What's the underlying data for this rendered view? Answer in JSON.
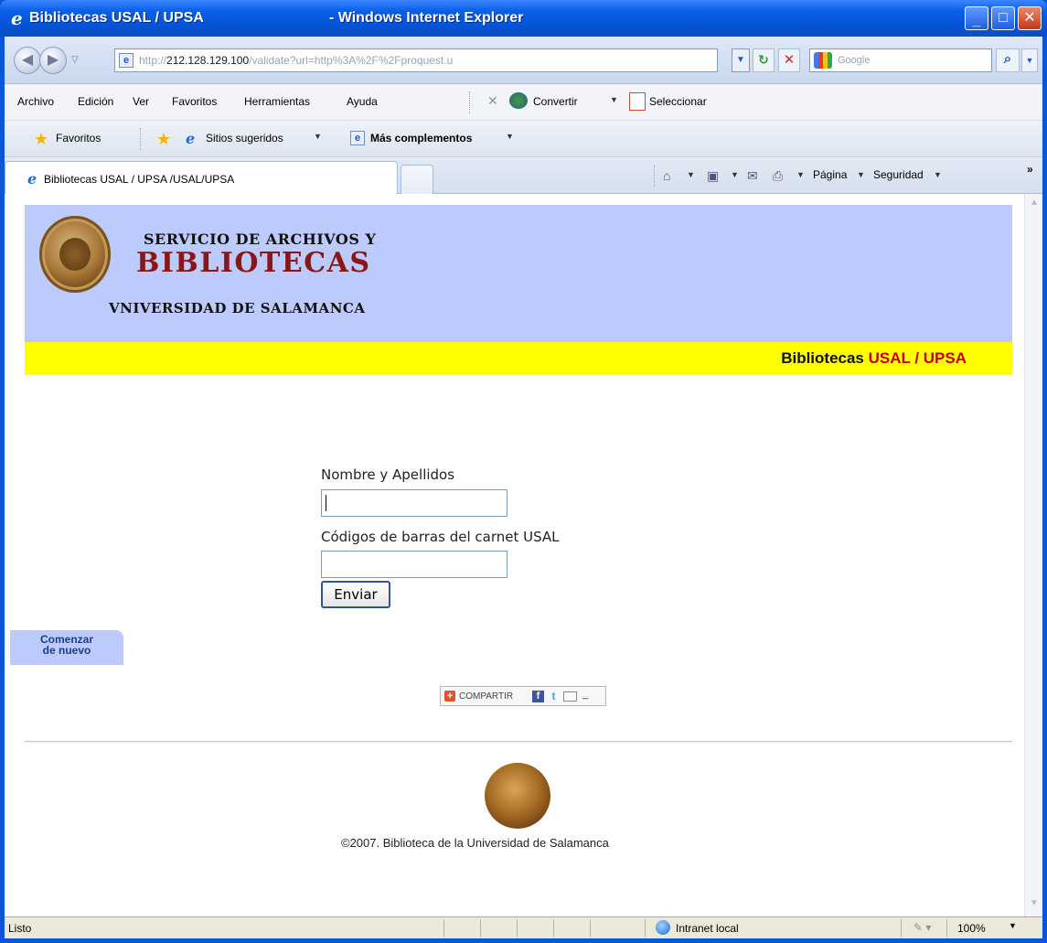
{
  "window": {
    "title": "Bibliotecas USAL / UPSA",
    "app": "- Windows Internet Explorer",
    "min_glyph": "_",
    "max_glyph": "□",
    "close_glyph": "✕"
  },
  "address_bar": {
    "url_prefix": "http://",
    "url_host": "212.128.129.100",
    "url_rest": "/validate?url=http%3A%2F%2Fproquest.u",
    "search_placeholder": "Google"
  },
  "menu": {
    "items": [
      "Archivo",
      "Edición",
      "Ver",
      "Favoritos",
      "Herramientas",
      "Ayuda"
    ],
    "convertir": "Convertir",
    "seleccionar": "Seleccionar"
  },
  "favorites_bar": {
    "favoritos": "Favoritos",
    "sitios": "Sitios sugeridos",
    "mas": "Más complementos"
  },
  "tabs": {
    "active_label": "Bibliotecas USAL / UPSA /USAL/UPSA",
    "pagina": "Página",
    "seguridad": "Seguridad"
  },
  "page": {
    "banner": {
      "line1": "SERVICIO DE ARCHIVOS Y",
      "line2": "BIBLIOTECAS",
      "line3": "VNIVERSIDAD DE SALAMANCA"
    },
    "brand_a": "Bibliotecas",
    "brand_b": "USAL / UPSA",
    "form": {
      "name_label": "Nombre y Apellidos",
      "name_value": "",
      "barcode_label": "Códigos de barras del carnet USAL",
      "barcode_value": "",
      "submit": "Enviar"
    },
    "restart": {
      "line1": "Comenzar",
      "line2": "de nuevo"
    },
    "share": {
      "label": "COMPARTIR",
      "plus": "+",
      "fb": "f",
      "tw": "t",
      "more": "_"
    },
    "copyright": "©2007. Biblioteca de la Universidad de Salamanca"
  },
  "status": {
    "text": "Listo",
    "zone": "Intranet local",
    "zoom": "100%"
  },
  "colors": {
    "banner_bg": "#bdcbfc",
    "band_bg": "#ffff00",
    "title_red": "#8a1616",
    "brand_red": "#c40000"
  },
  "icons": [
    "ie-logo-icon",
    "back-icon",
    "forward-icon",
    "page-icon",
    "refresh-icon",
    "stop-icon",
    "google-icon",
    "search-icon",
    "star-icon",
    "convert-icon",
    "select-icon",
    "home-icon",
    "feed-icon",
    "mail-icon",
    "print-icon",
    "seal-icon",
    "share-icon",
    "globe-icon"
  ]
}
